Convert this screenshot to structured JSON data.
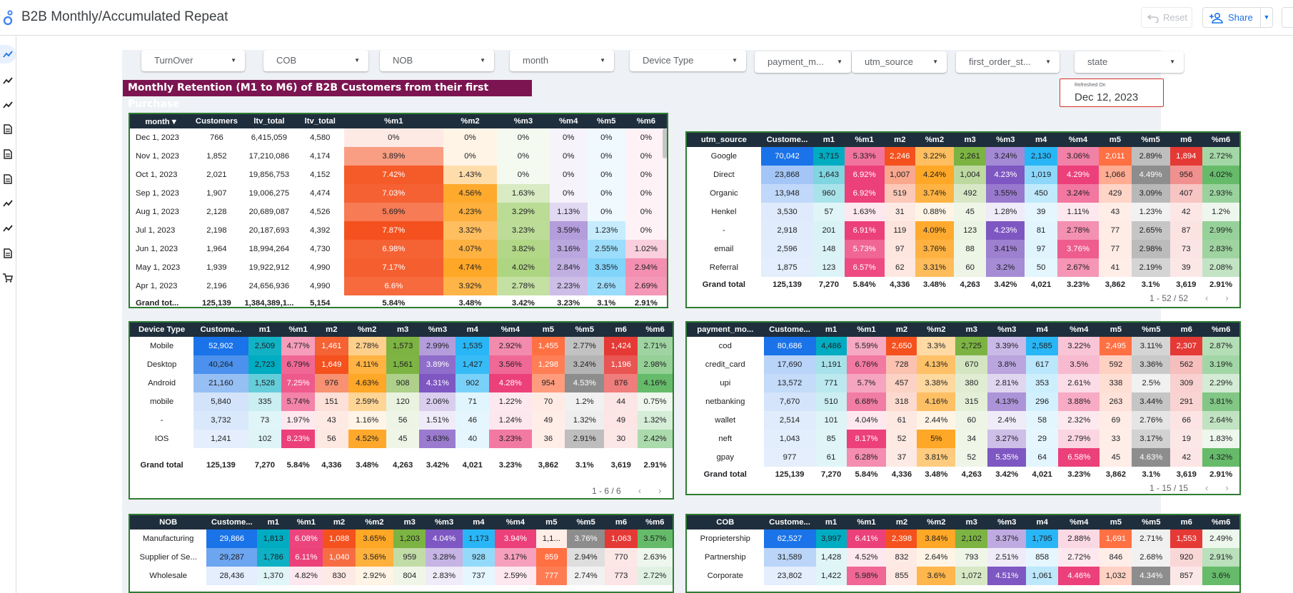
{
  "app": {
    "title": "B2B Monthly/Accumulated Repeat",
    "reset_label": "Reset",
    "share_label": "Share"
  },
  "filters": [
    "TurnOver",
    "COB",
    "NOB",
    "month",
    "Device Type",
    "payment_m...",
    "utm_source",
    "first_order_st...",
    "state"
  ],
  "banner": "Monthly Retention (M1 to M6) of B2B Customers from their first Purchase",
  "refresh": {
    "label": "Refreshed On",
    "value": "Dec 12, 2023"
  },
  "month_table": {
    "headers": [
      "month ▾",
      "Customers",
      "ltv_total",
      "ltv_total",
      "%m1",
      "%m2",
      "%m3",
      "%m4",
      "%m5",
      "%m6"
    ],
    "rows": [
      [
        "Dec 1, 2023",
        "766",
        "6,415,059",
        "4,580",
        "0%",
        "0%",
        "0%",
        "0%",
        "0%",
        "0%"
      ],
      [
        "Nov 1, 2023",
        "1,852",
        "17,210,086",
        "4,174",
        "3.89%",
        "0%",
        "0%",
        "0%",
        "0%",
        "0%"
      ],
      [
        "Oct 1, 2023",
        "2,021",
        "19,856,753",
        "4,152",
        "7.42%",
        "1.43%",
        "0%",
        "0%",
        "0%",
        "0%"
      ],
      [
        "Sep 1, 2023",
        "1,907",
        "19,006,275",
        "4,474",
        "7.03%",
        "4.56%",
        "1.63%",
        "0%",
        "0%",
        "0%"
      ],
      [
        "Aug 1, 2023",
        "2,128",
        "20,689,087",
        "4,526",
        "5.69%",
        "4.23%",
        "3.29%",
        "1.13%",
        "0%",
        "0%"
      ],
      [
        "Jul 1, 2023",
        "2,198",
        "20,187,693",
        "4,392",
        "7.87%",
        "3.32%",
        "3.23%",
        "3.59%",
        "1.23%",
        "0%"
      ],
      [
        "Jun 1, 2023",
        "1,964",
        "18,994,264",
        "4,730",
        "6.98%",
        "4.07%",
        "3.82%",
        "3.16%",
        "2.55%",
        "1.02%"
      ],
      [
        "May 1, 2023",
        "1,939",
        "19,922,912",
        "4,990",
        "7.17%",
        "4.74%",
        "4.02%",
        "2.84%",
        "3.35%",
        "2.94%"
      ],
      [
        "Apr 1, 2023",
        "2,196",
        "24,656,936",
        "4,990",
        "6.6%",
        "3.92%",
        "2.78%",
        "2.23%",
        "2.6%",
        "2.69%"
      ]
    ],
    "total": [
      "Grand tot...",
      "125,139",
      "1,384,389,1...",
      "5,154",
      "5.84%",
      "3.48%",
      "3.42%",
      "3.23%",
      "3.1%",
      "2.91%"
    ]
  },
  "utm_table": {
    "headers": [
      "utm_source",
      "Custome...",
      "m1",
      "%m1",
      "m2",
      "%m2",
      "m3",
      "%m3",
      "m4",
      "%m4",
      "m5",
      "%m5",
      "m6",
      "%m6"
    ],
    "rows": [
      [
        "Google",
        "70,042",
        "3,715",
        "5.33%",
        "2,246",
        "3.22%",
        "2,261",
        "3.24%",
        "2,130",
        "3.06%",
        "2,011",
        "2.89%",
        "1,894",
        "2.72%"
      ],
      [
        "Direct",
        "23,868",
        "1,643",
        "6.92%",
        "1,007",
        "4.24%",
        "1,004",
        "4.23%",
        "1,019",
        "4.29%",
        "1,066",
        "4.49%",
        "956",
        "4.02%"
      ],
      [
        "Organic",
        "13,948",
        "960",
        "6.92%",
        "519",
        "3.74%",
        "492",
        "3.55%",
        "450",
        "3.24%",
        "429",
        "3.09%",
        "407",
        "2.93%"
      ],
      [
        "Henkel",
        "3,530",
        "57",
        "1.63%",
        "31",
        "0.88%",
        "45",
        "1.28%",
        "39",
        "1.11%",
        "43",
        "1.23%",
        "42",
        "1.2%"
      ],
      [
        "-",
        "2,918",
        "201",
        "6.91%",
        "119",
        "4.09%",
        "123",
        "4.23%",
        "81",
        "2.78%",
        "77",
        "2.65%",
        "87",
        "2.99%"
      ],
      [
        "email",
        "2,596",
        "148",
        "5.73%",
        "97",
        "3.76%",
        "88",
        "3.41%",
        "97",
        "3.76%",
        "77",
        "2.98%",
        "73",
        "2.83%"
      ],
      [
        "Referral",
        "1,875",
        "123",
        "6.57%",
        "62",
        "3.31%",
        "60",
        "3.2%",
        "50",
        "2.67%",
        "41",
        "2.19%",
        "39",
        "2.08%"
      ]
    ],
    "total": [
      "Grand total",
      "125,139",
      "7,270",
      "5.84%",
      "4,336",
      "3.48%",
      "4,263",
      "3.42%",
      "4,021",
      "3.23%",
      "3,862",
      "3.1%",
      "3,619",
      "2.91%"
    ],
    "pager": "1 - 52 / 52"
  },
  "device_table": {
    "headers": [
      "Device Type",
      "Custome...",
      "m1",
      "%m1",
      "m2",
      "%m2",
      "m3",
      "%m3",
      "m4",
      "%m4",
      "m5",
      "%m5",
      "m6",
      "%m6"
    ],
    "rows": [
      [
        "Mobile",
        "52,902",
        "2,509",
        "4.77%",
        "1,461",
        "2.78%",
        "1,573",
        "2.99%",
        "1,535",
        "2.92%",
        "1,455",
        "2.77%",
        "1,424",
        "2.71%"
      ],
      [
        "Desktop",
        "40,264",
        "2,723",
        "6.79%",
        "1,649",
        "4.11%",
        "1,561",
        "3.89%",
        "1,427",
        "3.56%",
        "1,298",
        "3.24%",
        "1,196",
        "2.98%"
      ],
      [
        "Android",
        "21,160",
        "1,528",
        "7.25%",
        "976",
        "4.63%",
        "908",
        "4.31%",
        "902",
        "4.28%",
        "954",
        "4.53%",
        "876",
        "4.16%"
      ],
      [
        "mobile",
        "5,840",
        "335",
        "5.74%",
        "151",
        "2.59%",
        "120",
        "2.06%",
        "71",
        "1.22%",
        "70",
        "1.2%",
        "44",
        "0.75%"
      ],
      [
        "-",
        "3,732",
        "73",
        "1.97%",
        "43",
        "1.16%",
        "56",
        "1.51%",
        "46",
        "1.24%",
        "49",
        "1.32%",
        "49",
        "1.32%"
      ],
      [
        "IOS",
        "1,241",
        "102",
        "8.23%",
        "56",
        "4.52%",
        "45",
        "3.63%",
        "40",
        "3.23%",
        "36",
        "2.91%",
        "30",
        "2.42%"
      ]
    ],
    "total": [
      "Grand total",
      "125,139",
      "7,270",
      "5.84%",
      "4,336",
      "3.48%",
      "4,263",
      "3.42%",
      "4,021",
      "3.23%",
      "3,862",
      "3.1%",
      "3,619",
      "2.91%"
    ],
    "pager": "1 - 6 / 6"
  },
  "payment_table": {
    "headers": [
      "payment_mo...",
      "Custome...",
      "m1",
      "%m1",
      "m2",
      "%m2",
      "m3",
      "%m3",
      "m4",
      "%m4",
      "m5",
      "%m5",
      "m6",
      "%m6"
    ],
    "rows": [
      [
        "cod",
        "80,686",
        "4,486",
        "5.59%",
        "2,650",
        "3.3%",
        "2,725",
        "3.39%",
        "2,585",
        "3.22%",
        "2,495",
        "3.11%",
        "2,307",
        "2.87%"
      ],
      [
        "credit_card",
        "17,690",
        "1,191",
        "6.76%",
        "728",
        "4.13%",
        "670",
        "3.8%",
        "617",
        "3.5%",
        "592",
        "3.36%",
        "562",
        "3.19%"
      ],
      [
        "upi",
        "13,572",
        "771",
        "5.7%",
        "457",
        "3.38%",
        "380",
        "2.81%",
        "353",
        "2.61%",
        "338",
        "2.5%",
        "309",
        "2.29%"
      ],
      [
        "netbanking",
        "7,670",
        "510",
        "6.68%",
        "318",
        "4.16%",
        "315",
        "4.13%",
        "296",
        "3.88%",
        "263",
        "3.44%",
        "291",
        "3.81%"
      ],
      [
        "wallet",
        "2,514",
        "101",
        "4.04%",
        "61",
        "2.44%",
        "60",
        "2.4%",
        "58",
        "2.32%",
        "69",
        "2.76%",
        "66",
        "2.64%"
      ],
      [
        "neft",
        "1,043",
        "85",
        "8.17%",
        "52",
        "5%",
        "34",
        "3.27%",
        "29",
        "2.79%",
        "33",
        "3.17%",
        "19",
        "1.83%"
      ],
      [
        "gpay",
        "977",
        "61",
        "6.28%",
        "37",
        "3.81%",
        "52",
        "5.35%",
        "64",
        "6.58%",
        "45",
        "4.63%",
        "42",
        "4.32%"
      ]
    ],
    "total": [
      "Grand total",
      "125,139",
      "7,270",
      "5.84%",
      "4,336",
      "3.48%",
      "4,263",
      "3.42%",
      "4,021",
      "3.23%",
      "3,862",
      "3.1%",
      "3,619",
      "2.91%"
    ],
    "pager": "1 - 15 / 15"
  },
  "nob_table": {
    "headers": [
      "NOB",
      "Custome...",
      "m1",
      "%m1",
      "m2",
      "%m2",
      "m3",
      "%m3",
      "m4",
      "%m4",
      "m5",
      "%m5",
      "m6",
      "%m6"
    ],
    "rows": [
      [
        "Manufacturing",
        "29,866",
        "1,813",
        "6.08%",
        "1,088",
        "3.65%",
        "1,203",
        "4.04%",
        "1,173",
        "3.94%",
        "1,1...",
        "3.76%",
        "1,063",
        "3.57%"
      ],
      [
        "Supplier of Se...",
        "29,287",
        "1,786",
        "6.11%",
        "1,040",
        "3.56%",
        "959",
        "3.28%",
        "928",
        "3.17%",
        "859",
        "2.94%",
        "770",
        "2.63%"
      ],
      [
        "Wholesale",
        "28,436",
        "1,370",
        "4.82%",
        "830",
        "2.92%",
        "804",
        "2.83%",
        "737",
        "2.59%",
        "777",
        "2.74%",
        "773",
        "2.72%"
      ]
    ]
  },
  "cob_table": {
    "headers": [
      "COB",
      "Custome...",
      "m1",
      "%m1",
      "m2",
      "%m2",
      "m3",
      "%m3",
      "m4",
      "%m4",
      "m5",
      "%m5",
      "m6",
      "%m6"
    ],
    "rows": [
      [
        "Proprietership",
        "62,527",
        "3,997",
        "6.41%",
        "2,398",
        "3.84%",
        "2,102",
        "3.37%",
        "1,795",
        "2.88%",
        "1,691",
        "2.71%",
        "1,553",
        "2.49%"
      ],
      [
        "Partnership",
        "31,589",
        "1,428",
        "4.52%",
        "832",
        "2.64%",
        "793",
        "2.51%",
        "858",
        "2.72%",
        "846",
        "2.68%",
        "920",
        "2.91%"
      ],
      [
        "Corporate",
        "23,802",
        "1,422",
        "5.98%",
        "855",
        "3.6%",
        "1,072",
        "4.51%",
        "1,061",
        "4.46%",
        "1,032",
        "4.34%",
        "857",
        "3.6%"
      ]
    ]
  },
  "colors": {
    "banner": "#7b1450",
    "header": "#1f2e3c",
    "border": "#2e7d32",
    "customers": [
      "#1a73e8",
      "#4fa3f7",
      "#9ccaf8",
      "#d2e6fb",
      "#e9f2fd"
    ],
    "pct": {
      "%m1": "#ec407a",
      "m2": "#ff7a2e",
      "%m2": "#fb8c00",
      "m3": "#7cb342",
      "%m3": "#7e57c2",
      "m4": "#29b6f6",
      "%m4": "#ec407a",
      "m5": "#ff7043",
      "%m5": "#9e9e9e",
      "m6": "#e53935",
      "%m6": "#66bb6a"
    }
  }
}
